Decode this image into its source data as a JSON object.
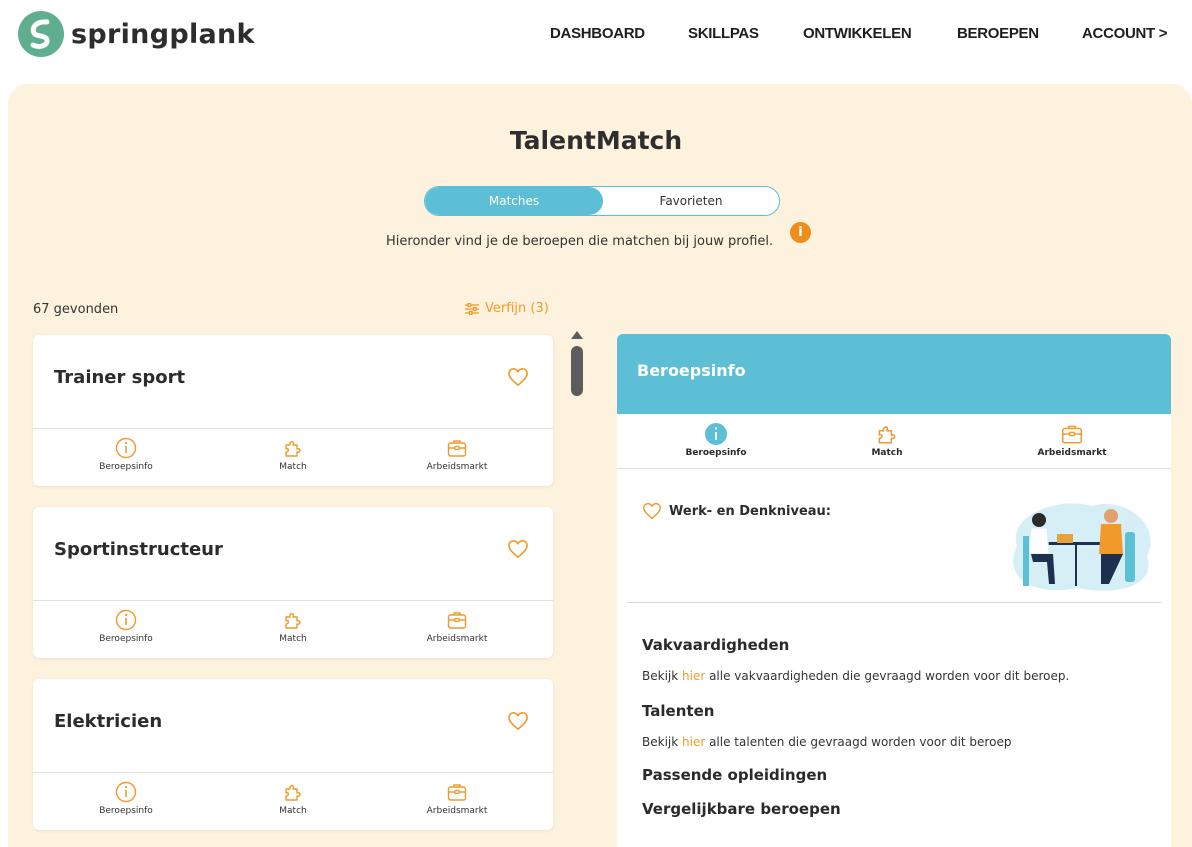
{
  "brand": {
    "name": "springplank",
    "accent": "#5cbfd5",
    "orange": "#f09a2b",
    "panel_bg": "#fdf2de"
  },
  "nav": {
    "dashboard": "DASHBOARD",
    "skillpas": "SKILLPAS",
    "ontwikkelen": "ONTWIKKELEN",
    "beroepen": "BEROEPEN",
    "account": "ACCOUNT >"
  },
  "page": {
    "title": "TalentMatch",
    "tabs": {
      "matches": "Matches",
      "favorieten": "Favorieten"
    },
    "subtitle": "Hieronder vind je de beroepen die matchen bij jouw profiel.",
    "info_icon": "i",
    "found": "67 gevonden",
    "refine": "Verfijn (3)"
  },
  "cards": [
    {
      "title": "Trainer sport",
      "actions": [
        "Beroepsinfo",
        "Match",
        "Arbeidsmarkt"
      ]
    },
    {
      "title": "Sportinstructeur",
      "actions": [
        "Beroepsinfo",
        "Match",
        "Arbeidsmarkt"
      ]
    },
    {
      "title": "Elektricien",
      "actions": [
        "Beroepsinfo",
        "Match",
        "Arbeidsmarkt"
      ]
    }
  ],
  "detail": {
    "header": "Beroepsinfo",
    "tabs": [
      "Beroepsinfo",
      "Match",
      "Arbeidsmarkt"
    ],
    "werk_denkniveau": "Werk- en Denkniveau:",
    "vakvaardigheden": {
      "heading": "Vakvaardigheden",
      "pre": "Bekijk ",
      "link": "hier",
      "post": " alle vakvaardigheden die gevraagd worden voor dit beroep."
    },
    "talenten": {
      "heading": "Talenten",
      "pre": "Bekijk ",
      "link": "hier",
      "post": " alle talenten die gevraagd worden voor dit beroep"
    },
    "passende_opleidingen": "Passende opleidingen",
    "vergelijkbare_beroepen": "Vergelijkbare beroepen"
  }
}
